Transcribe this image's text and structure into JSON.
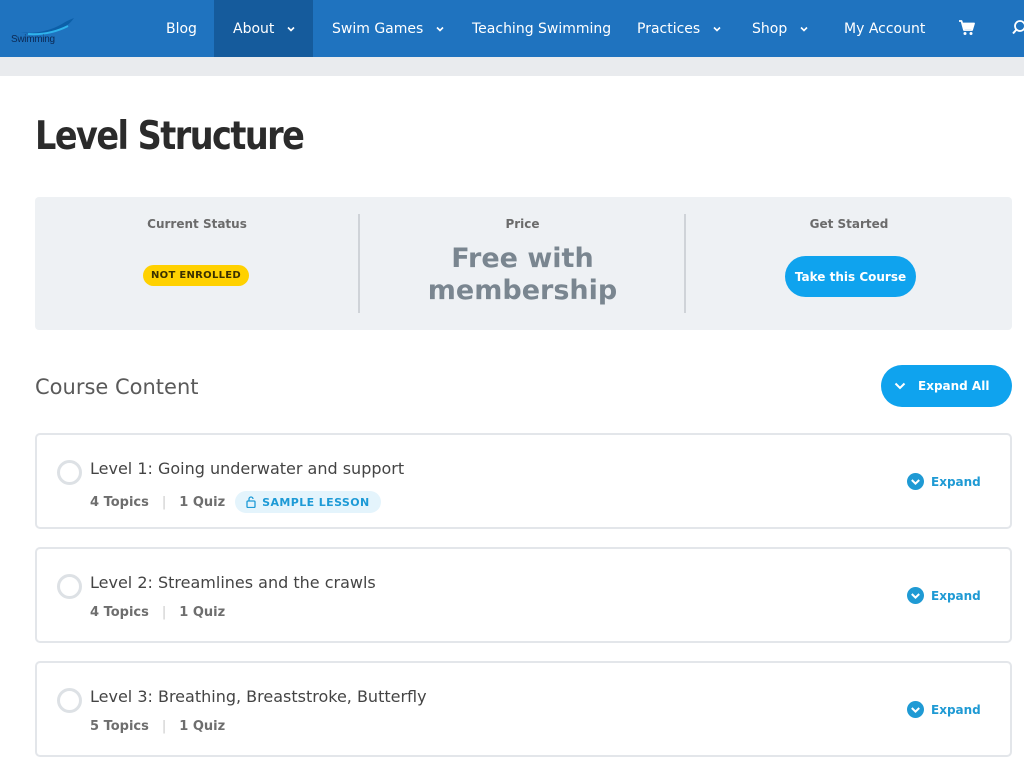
{
  "colors": {
    "nav": "#1f73bf",
    "nav_active": "#155b9c",
    "accent": "#0fa3ee",
    "badge": "#ffd100"
  },
  "nav": {
    "logo_text": "Swimming",
    "items": [
      {
        "label": "Blog",
        "dropdown": false
      },
      {
        "label": "About",
        "dropdown": true,
        "active": true
      },
      {
        "label": "Swim Games",
        "dropdown": true
      },
      {
        "label": "Teaching Swimming",
        "dropdown": false
      },
      {
        "label": "Practices",
        "dropdown": true
      },
      {
        "label": "Shop",
        "dropdown": true
      },
      {
        "label": "My Account",
        "dropdown": false
      }
    ],
    "icons": [
      "cart-icon",
      "search-icon"
    ]
  },
  "page": {
    "title": "Level Structure"
  },
  "status": {
    "current_status_label": "Current Status",
    "badge": "NOT ENROLLED",
    "price_label": "Price",
    "price_line1": "Free with",
    "price_line2": "membership",
    "get_started_label": "Get Started",
    "take_course": "Take this Course"
  },
  "content": {
    "title": "Course Content",
    "expand_all": "Expand All",
    "levels": [
      {
        "title": "Level 1: Going underwater and support",
        "topics": "4 Topics",
        "quiz": "1 Quiz",
        "sample": "SAMPLE LESSON",
        "expand": "Expand"
      },
      {
        "title": "Level 2: Streamlines and the crawls",
        "topics": "4 Topics",
        "quiz": "1 Quiz",
        "expand": "Expand"
      },
      {
        "title": "Level 3: Breathing, Breaststroke, Butterfly",
        "topics": "5 Topics",
        "quiz": "1 Quiz",
        "expand": "Expand"
      }
    ]
  }
}
